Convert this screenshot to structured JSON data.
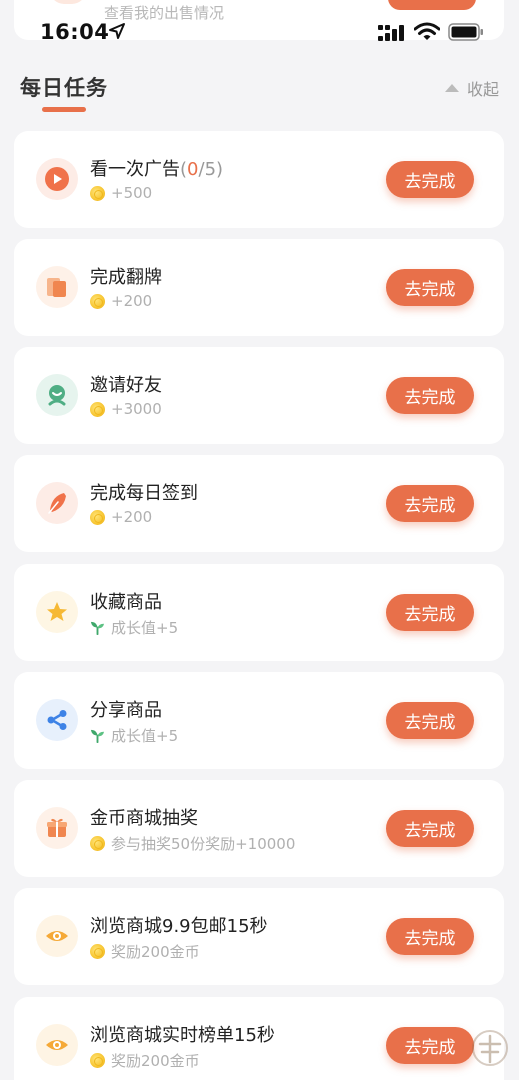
{
  "status_bar": {
    "time": "16:04"
  },
  "prev_card": {
    "subtitle": "查看我的出售情况"
  },
  "section": {
    "title": "每日任务",
    "collapse_label": "收起"
  },
  "accent_color": "#e8704a",
  "tasks": [
    {
      "title": "看一次广告",
      "progress": {
        "done": "0",
        "total": "5",
        "open": "(",
        "sep": "/",
        "close": ")"
      },
      "reward": "+500",
      "reward_type": "coin",
      "icon": "play-icon",
      "button": "去完成"
    },
    {
      "title": "完成翻牌",
      "reward": "+200",
      "reward_type": "coin",
      "icon": "cards-icon",
      "button": "去完成"
    },
    {
      "title": "邀请好友",
      "reward": "+3000",
      "reward_type": "coin",
      "icon": "friend-icon",
      "button": "去完成"
    },
    {
      "title": "完成每日签到",
      "reward": "+200",
      "reward_type": "coin",
      "icon": "feather-icon",
      "button": "去完成"
    },
    {
      "title": "收藏商品",
      "reward": "成长值+5",
      "reward_type": "growth",
      "icon": "star-icon",
      "button": "去完成"
    },
    {
      "title": "分享商品",
      "reward": "成长值+5",
      "reward_type": "growth",
      "icon": "share-icon",
      "button": "去完成"
    },
    {
      "title": "金币商城抽奖",
      "reward": "参与抽奖50份奖励+10000",
      "reward_type": "coin",
      "icon": "gift-icon",
      "button": "去完成"
    },
    {
      "title": "浏览商城9.9包邮15秒",
      "reward": "奖励200金币",
      "reward_type": "coin",
      "icon": "eye-icon",
      "button": "去完成"
    },
    {
      "title": "浏览商城实时榜单15秒",
      "reward": "奖励200金币",
      "reward_type": "coin",
      "icon": "eye-icon",
      "button": "去完成"
    }
  ]
}
